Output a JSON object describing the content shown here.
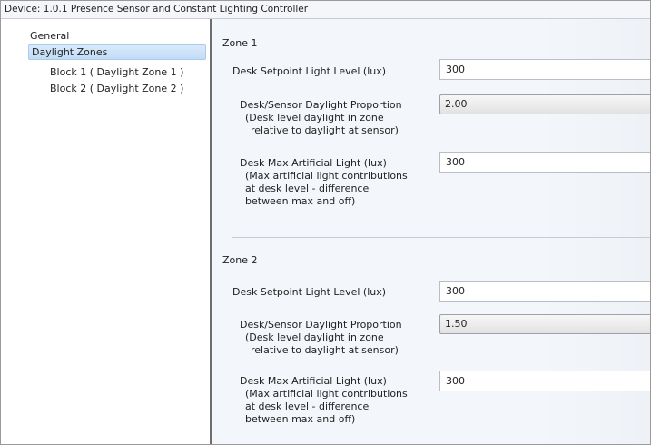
{
  "window": {
    "title": "Device: 1.0.1  Presence Sensor and Constant Lighting Controller"
  },
  "sidebar": {
    "items": [
      {
        "label": "General"
      },
      {
        "label": "Daylight Zones"
      },
      {
        "label": "Block 1 ( Daylight Zone 1 )"
      },
      {
        "label": "Block 2 ( Daylight Zone 2 )"
      }
    ],
    "selected": "Daylight Zones"
  },
  "zones": [
    {
      "title": "Zone 1",
      "setpoint": {
        "label": "Desk Setpoint Light Level (lux)",
        "value": "300"
      },
      "proportion": {
        "label": "Desk/Sensor Daylight Proportion",
        "desc1": "(Desk level daylight in zone",
        "desc2": "relative to daylight at sensor)",
        "value": "2.00"
      },
      "max_light": {
        "label": "Desk Max Artificial Light (lux)",
        "desc1": "(Max artificial light contributions",
        "desc2": "at desk level - difference",
        "desc3": "between max and off)",
        "value": "300"
      }
    },
    {
      "title": "Zone 2",
      "setpoint": {
        "label": "Desk Setpoint Light Level (lux)",
        "value": "300"
      },
      "proportion": {
        "label": "Desk/Sensor Daylight Proportion",
        "desc1": "(Desk level daylight in zone",
        "desc2": "relative to daylight at sensor)",
        "value": "1.50"
      },
      "max_light": {
        "label": "Desk Max Artificial Light (lux)",
        "desc1": "(Max artificial light contributions",
        "desc2": "at desk level - difference",
        "desc3": "between max and off)",
        "value": "300"
      }
    }
  ]
}
